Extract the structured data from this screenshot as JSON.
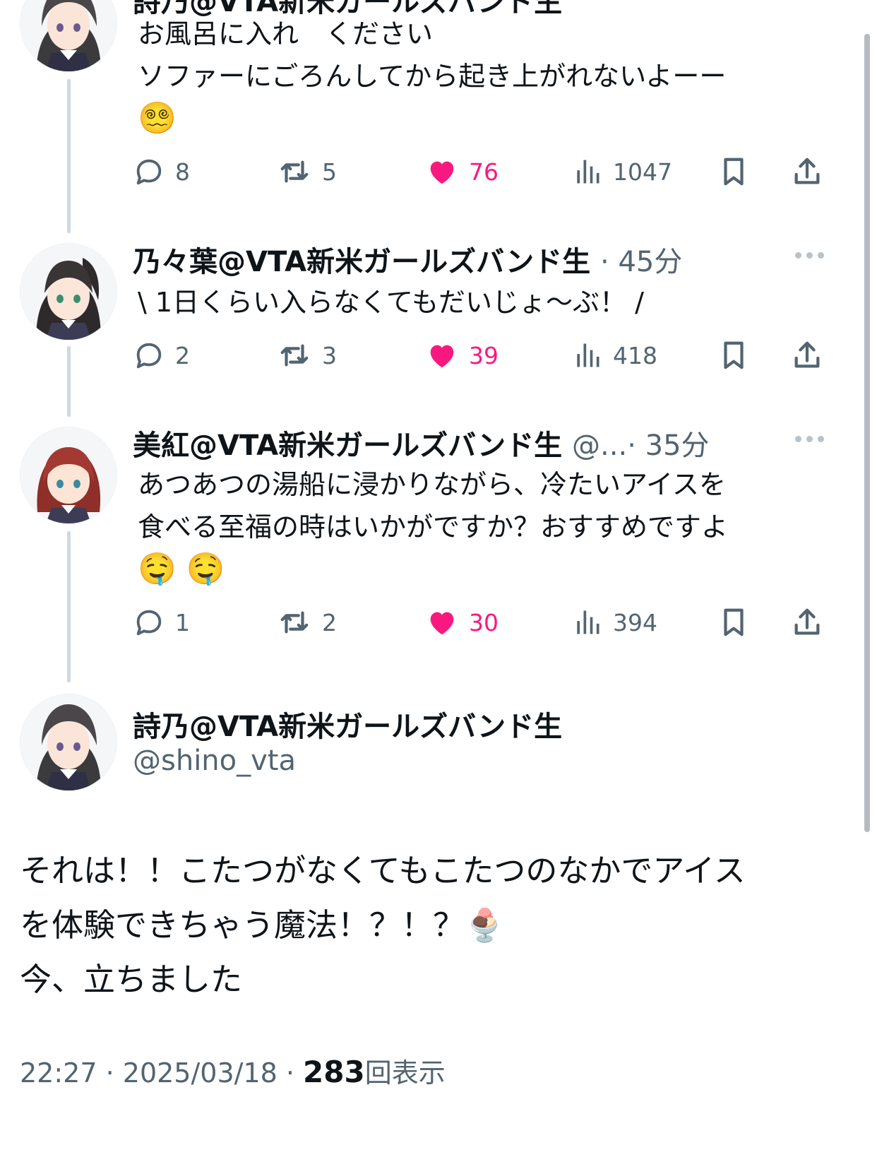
{
  "tweets": [
    {
      "name": "詩乃@VTA新米ガールズバンド生",
      "lines": [
        "お風呂に入れ　ください",
        "ソファーにごろんしてから起き上がれないよーー"
      ],
      "emoji": [
        "😵‍💫"
      ],
      "replies": "8",
      "retweets": "5",
      "likes": "76",
      "views": "1047"
    },
    {
      "name": "乃々葉@VTA新米ガールズバンド生",
      "time": "· 45分",
      "lines": [
        "\\ 1日くらい入らなくてもだいじょ〜ぶ！ /"
      ],
      "replies": "2",
      "retweets": "3",
      "likes": "39",
      "views": "418"
    },
    {
      "name": "美紅@VTA新米ガールズバンド生",
      "handle": "@...",
      "time": "· 35分",
      "lines": [
        "あつあつの湯船に浸かりながら、冷たいアイスを",
        "食べる至福の時はいかがですか？おすすめですよ"
      ],
      "emoji": [
        "🤤",
        "🤤"
      ],
      "replies": "1",
      "retweets": "2",
      "likes": "30",
      "views": "394"
    }
  ],
  "main": {
    "name": "詩乃@VTA新米ガールズバンド生",
    "handle": "@shino_vta",
    "lines": [
      "それは！！こたつがなくてもこたつのなかでアイス",
      "を体験できちゃう魔法！？！？",
      "今、立ちました"
    ],
    "line2_emoji": "🍨",
    "time": "22:27",
    "date": "2025/03/18",
    "views_count": "283",
    "views_label": "回表示",
    "separator": " · "
  },
  "colors": {
    "like": "#f91880",
    "muted": "#536471",
    "text": "#0f1419",
    "thread": "#cfd9de"
  },
  "icons": [
    "reply-icon",
    "retweet-icon",
    "heart-icon",
    "views-icon",
    "bookmark-icon",
    "share-icon",
    "more-icon"
  ]
}
